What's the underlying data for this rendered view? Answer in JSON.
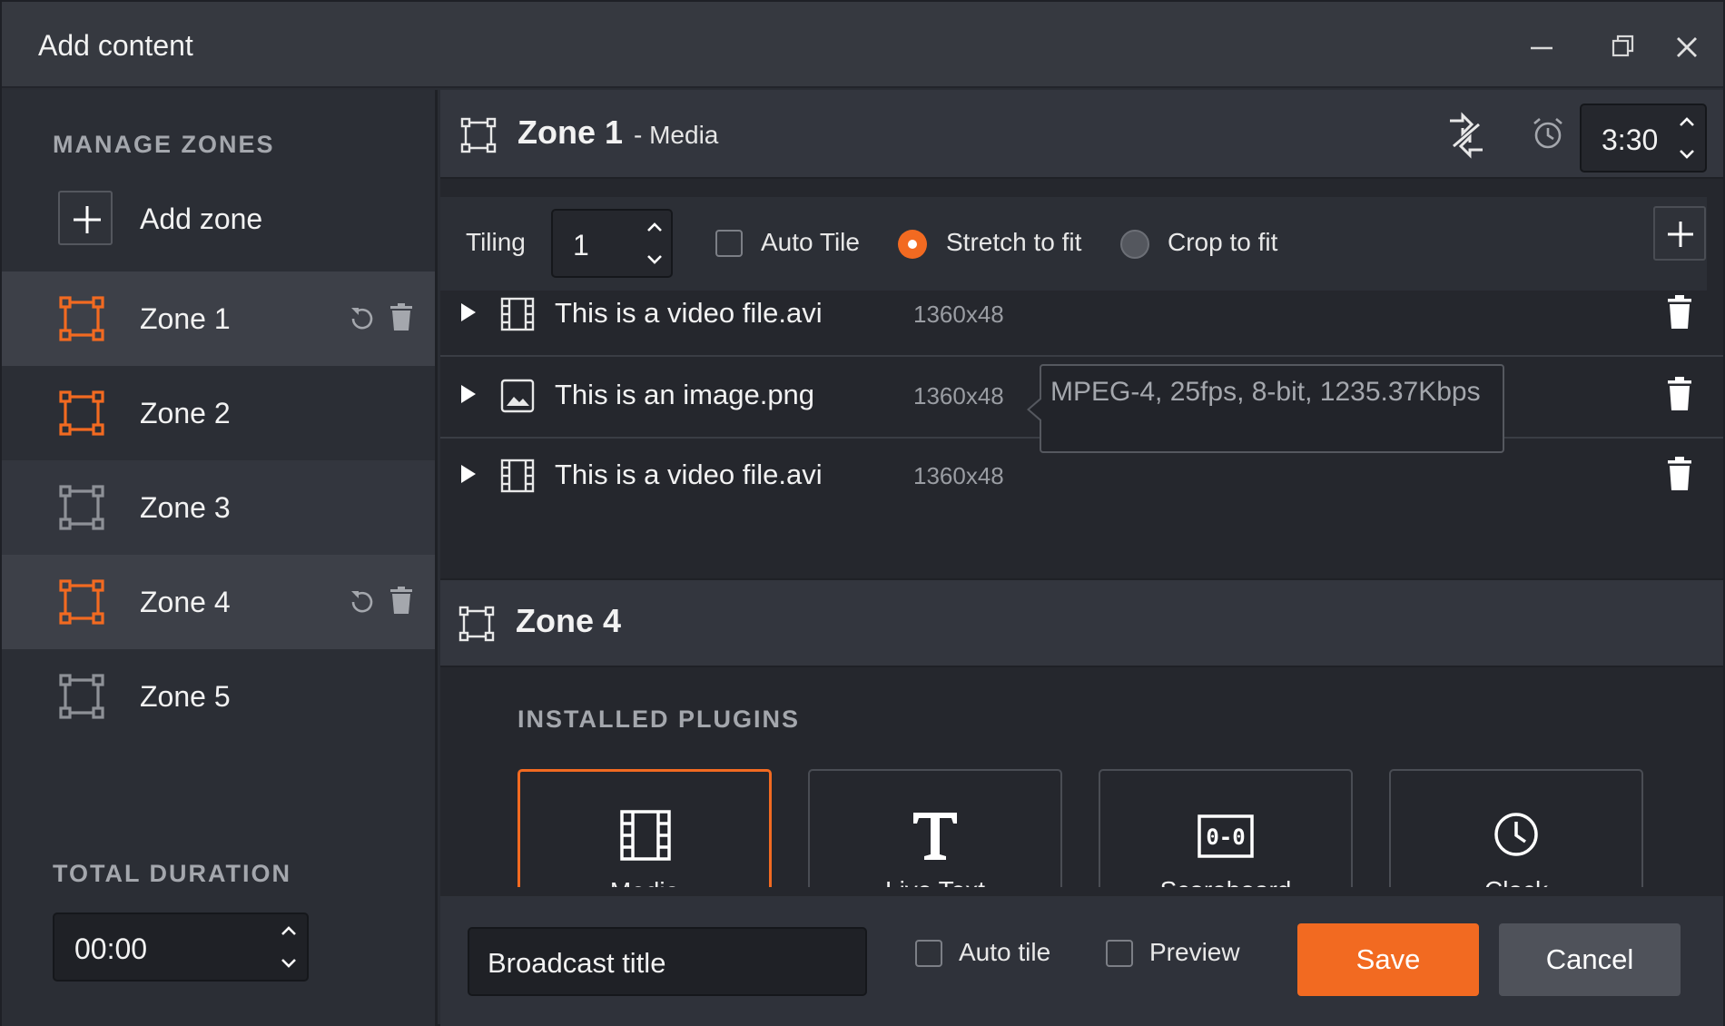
{
  "window": {
    "title": "Add content",
    "controls": [
      "minimize-icon",
      "restore-icon",
      "close-icon"
    ]
  },
  "sidebar": {
    "manage_zones_label": "MANAGE ZONES",
    "add_zone_label": "Add zone",
    "zones": [
      {
        "label": "Zone 1",
        "active_icon": true,
        "selected": true,
        "has_actions": true
      },
      {
        "label": "Zone 2",
        "active_icon": true,
        "selected": false,
        "has_actions": false
      },
      {
        "label": "Zone 3",
        "active_icon": false,
        "selected": false,
        "has_actions": false
      },
      {
        "label": "Zone 4",
        "active_icon": true,
        "selected": true,
        "has_actions": true
      },
      {
        "label": "Zone 5",
        "active_icon": false,
        "selected": false,
        "has_actions": false
      }
    ],
    "total_duration_label": "TOTAL DURATION",
    "total_duration_value": "00:00"
  },
  "zone1": {
    "title": "Zone 1",
    "subtitle": "- Media",
    "time_value": "3:30",
    "toolbar": {
      "tiling_label": "Tiling",
      "tiling_value": "1",
      "auto_tile_label": "Auto Tile",
      "auto_tile_checked": false,
      "stretch_label": "Stretch to fit",
      "crop_label": "Crop to fit",
      "fit_mode": "stretch"
    },
    "files": [
      {
        "name": "This is a video file.avi",
        "resolution": "1360x48",
        "type": "video"
      },
      {
        "name": "This is an image.png",
        "resolution": "1360x48",
        "type": "image"
      },
      {
        "name": "This is a video file.avi",
        "resolution": "1360x48",
        "type": "video"
      }
    ],
    "tooltip": "MPEG-4, 25fps, 8-bit, 1235.37Kbps"
  },
  "zone4": {
    "title": "Zone 4",
    "installed_plugins_label": "INSTALLED PLUGINS",
    "plugins": [
      {
        "label": "Media",
        "icon": "film-icon",
        "selected": true
      },
      {
        "label": "Live Text",
        "icon": "text-icon",
        "selected": false
      },
      {
        "label": "Scoreboard",
        "icon": "scoreboard-icon",
        "selected": false
      },
      {
        "label": "Clock",
        "icon": "clock-icon",
        "selected": false
      }
    ]
  },
  "footer": {
    "broadcast_title_placeholder": "Broadcast title",
    "auto_tile_label": "Auto tile",
    "preview_label": "Preview",
    "save_label": "Save",
    "cancel_label": "Cancel"
  },
  "colors": {
    "accent": "#f26a21",
    "background": "#25272d",
    "panel": "#2b2e35",
    "selected_row": "#3d4048"
  }
}
